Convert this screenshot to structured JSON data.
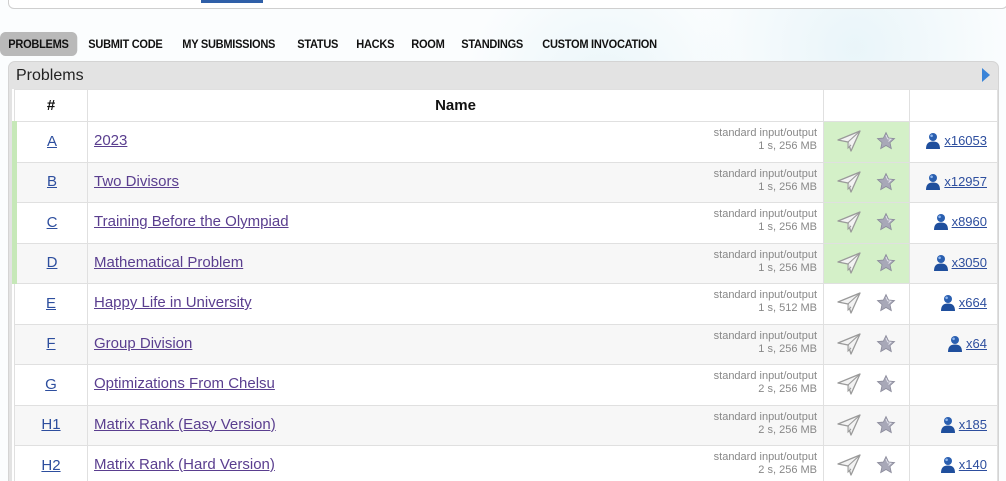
{
  "nav": {
    "items": [
      {
        "label": "PROBLEMS",
        "active": true
      },
      {
        "label": "SUBMIT CODE",
        "active": false
      },
      {
        "label": "MY SUBMISSIONS",
        "active": false
      },
      {
        "label": "STATUS",
        "active": false
      },
      {
        "label": "HACKS",
        "active": false
      },
      {
        "label": "ROOM",
        "active": false
      },
      {
        "label": "STANDINGS",
        "active": false
      },
      {
        "label": "CUSTOM INVOCATION",
        "active": false
      }
    ]
  },
  "panel": {
    "title": "Problems"
  },
  "table": {
    "headers": {
      "index": "#",
      "name": "Name"
    },
    "rows": [
      {
        "index": "A",
        "name": "2023",
        "io": "standard input/output",
        "limits": "1 s, 256 MB",
        "solved": true,
        "solvers": "x16053"
      },
      {
        "index": "B",
        "name": "Two Divisors",
        "io": "standard input/output",
        "limits": "1 s, 256 MB",
        "solved": true,
        "solvers": "x12957"
      },
      {
        "index": "C",
        "name": "Training Before the Olympiad",
        "io": "standard input/output",
        "limits": "1 s, 256 MB",
        "solved": true,
        "solvers": "x8960"
      },
      {
        "index": "D",
        "name": "Mathematical Problem",
        "io": "standard input/output",
        "limits": "1 s, 256 MB",
        "solved": true,
        "solvers": "x3050"
      },
      {
        "index": "E",
        "name": "Happy Life in University",
        "io": "standard input/output",
        "limits": "1 s, 512 MB",
        "solved": false,
        "solvers": "x664"
      },
      {
        "index": "F",
        "name": "Group Division",
        "io": "standard input/output",
        "limits": "1 s, 256 MB",
        "solved": false,
        "solvers": "x64"
      },
      {
        "index": "G",
        "name": "Optimizations From Chelsu",
        "io": "standard input/output",
        "limits": "2 s, 256 MB",
        "solved": false,
        "solvers": ""
      },
      {
        "index": "H1",
        "name": "Matrix Rank (Easy Version)",
        "io": "standard input/output",
        "limits": "2 s, 256 MB",
        "solved": false,
        "solvers": "x185"
      },
      {
        "index": "H2",
        "name": "Matrix Rank (Hard Version)",
        "io": "standard input/output",
        "limits": "2 s, 256 MB",
        "solved": false,
        "solvers": "x140"
      }
    ]
  },
  "colors": {
    "solved_bg": "#d4f0c8",
    "solved_mark": "#c6e8b8",
    "link_index": "#2d4e9e",
    "link_name": "#5a3e8f",
    "active_tab": "#b9b9b9"
  },
  "icons": {
    "submit": "paper-plane-icon",
    "favorite": "star-icon",
    "solvers": "user-icon",
    "panel_toggle": "triangle-right-icon"
  }
}
